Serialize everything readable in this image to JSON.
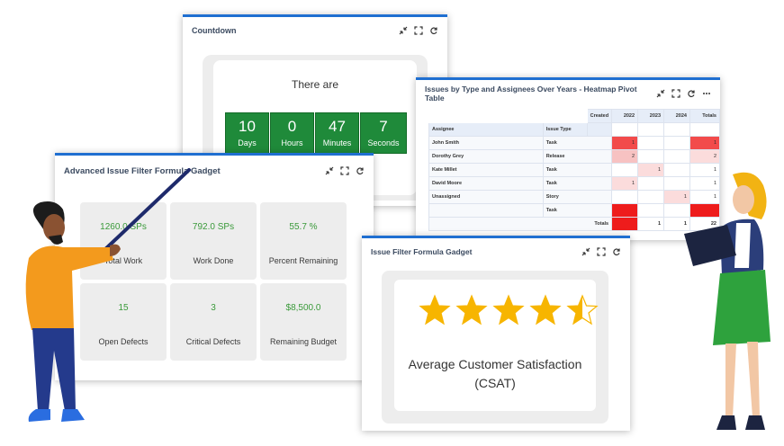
{
  "countdown": {
    "title": "Countdown",
    "intro": "There are",
    "units": [
      {
        "value": "10",
        "label": "Days"
      },
      {
        "value": "0",
        "label": "Hours"
      },
      {
        "value": "47",
        "label": "Minutes"
      },
      {
        "value": "7",
        "label": "Seconds"
      }
    ]
  },
  "heatmap": {
    "title": "Issues by Type and Assignees Over Years - Heatmap Pivot Table",
    "created_label": "Created",
    "headers": {
      "assignee": "Assignee",
      "issue_type": "Issue Type",
      "y2022": "2022",
      "y2023": "2023",
      "y2024": "2024",
      "totals": "Totals"
    },
    "rows": [
      {
        "assignee": "John Smith",
        "type": "Task",
        "y2022": "1",
        "y2023": "",
        "y2024": "",
        "total": "1"
      },
      {
        "assignee": "Dorothy Grey",
        "type": "Release",
        "y2022": "2",
        "y2023": "",
        "y2024": "",
        "total": "2"
      },
      {
        "assignee": "Kate Millet",
        "type": "Task",
        "y2022": "",
        "y2023": "1",
        "y2024": "",
        "total": "1"
      },
      {
        "assignee": "David Moore",
        "type": "Task",
        "y2022": "1",
        "y2023": "",
        "y2024": "",
        "total": "1"
      },
      {
        "assignee": "Unassigned",
        "type": "Story",
        "y2022": "",
        "y2023": "",
        "y2024": "1",
        "total": "1"
      },
      {
        "assignee": "",
        "type": "Task",
        "y2022": "",
        "y2023": "",
        "y2024": "",
        "total": ""
      }
    ],
    "totals_row": {
      "label": "Totals",
      "y2022": "",
      "y2023": "1",
      "y2024": "1",
      "total": "22"
    },
    "colors": {
      "strong": "#f24b4b",
      "medium": "#f7a3a3",
      "light": "#fbdcdc",
      "max": "#ee1c1c"
    }
  },
  "advanced": {
    "title": "Advanced Issue Filter Formula Gadget",
    "tiles": [
      {
        "value": "1260.0 SPs",
        "label": "Total Work"
      },
      {
        "value": "792.0 SPs",
        "label": "Work Done"
      },
      {
        "value": "55.7 %",
        "label": "Percent Remaining"
      },
      {
        "value": "15",
        "label": "Open Defects"
      },
      {
        "value": "3",
        "label": "Critical Defects"
      },
      {
        "value": "$8,500.0",
        "label": "Remaining Budget"
      }
    ]
  },
  "formula": {
    "title": "Issue Filter Formula Gadget",
    "rating": 4.5,
    "rating_max": 5,
    "label": "Average Customer Satisfaction (CSAT)",
    "star_color": "#f7b500"
  },
  "icons": {
    "collapse": "collapse-icon",
    "fullscreen": "fullscreen-icon",
    "refresh": "refresh-icon",
    "more": "more-icon"
  },
  "colors": {
    "accent": "#1f6fd1",
    "countdown_green": "#1f8a3a",
    "tile_value_green": "#3a9a3a"
  }
}
